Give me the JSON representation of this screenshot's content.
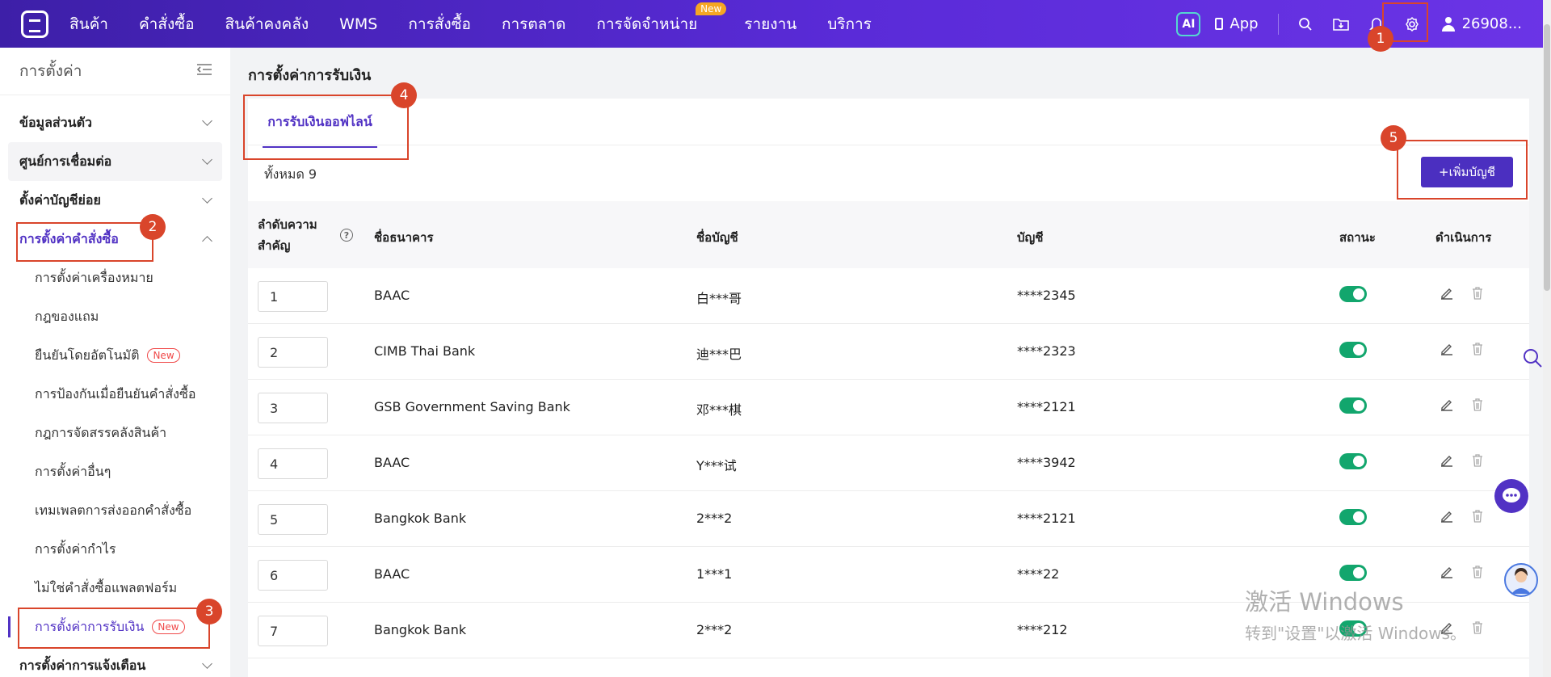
{
  "nav": {
    "items": [
      "สินค้า",
      "คำสั่งซื้อ",
      "สินค้าคงคลัง",
      "WMS",
      "การสั่งซื้อ",
      "การตลาด",
      "การจัดจำหน่าย",
      "รายงาน",
      "บริการ"
    ],
    "new_badge": "New",
    "ai_label": "AI",
    "app_label": "App",
    "user_label": "26908..."
  },
  "sidebar": {
    "title": "การตั้งค่า",
    "groups": [
      "ข้อมูลส่วนตัว",
      "ศูนย์การเชื่อมต่อ",
      "ตั้งค่าบัญชีย่อย",
      "การตั้งค่าคำสั่งซื้อ"
    ],
    "sub_items": [
      "การตั้งค่าเครื่องหมาย",
      "กฎของแถม",
      "ยืนยันโดยอัตโนมัติ",
      "การป้องกันเมื่อยืนยันคำสั่งซื้อ",
      "กฎการจัดสรรคลังสินค้า",
      "การตั้งค่าอื่นๆ",
      "เทมเพลตการส่งออกคำสั่งซื้อ",
      "การตั้งค่ากำไร",
      "ไม่ใช่คำสั่งซื้อแพลตฟอร์ม",
      "การตั้งค่าการรับเงิน"
    ],
    "new_tag": "New",
    "last_group": "การตั้งค่าการแจ้งเตือน"
  },
  "main": {
    "title": "การตั้งค่าการรับเงิน",
    "tab": "การรับเงินออฟไลน์",
    "total": "ทั้งหมด 9",
    "add_button": "+เพิ่มบัญชี",
    "headers": {
      "priority_line1": "ลำดับความ",
      "priority_line2": "สำคัญ",
      "help": "?",
      "bank": "ชื่อธนาคาร",
      "account_name": "ชื่อบัญชี",
      "account": "บัญชี",
      "status": "สถานะ",
      "actions": "ดำเนินการ"
    },
    "rows": [
      {
        "priority": "1",
        "bank": "BAAC",
        "account_name": "白***哥",
        "account": "****2345"
      },
      {
        "priority": "2",
        "bank": "CIMB Thai Bank",
        "account_name": "迪***巴",
        "account": "****2323"
      },
      {
        "priority": "3",
        "bank": "GSB Government Saving Bank",
        "account_name": "邓***棋",
        "account": "****2121"
      },
      {
        "priority": "4",
        "bank": "BAAC",
        "account_name": "Y***试",
        "account": "****3942"
      },
      {
        "priority": "5",
        "bank": "Bangkok Bank",
        "account_name": "2***2",
        "account": "****2121"
      },
      {
        "priority": "6",
        "bank": "BAAC",
        "account_name": "1***1",
        "account": "****22"
      },
      {
        "priority": "7",
        "bank": "Bangkok Bank",
        "account_name": "2***2",
        "account": "****212"
      }
    ]
  },
  "annotations": [
    "1",
    "2",
    "3",
    "4",
    "5"
  ],
  "watermark": {
    "line1": "激活 Windows",
    "line2": "转到\"设置\"以激活 Windows。"
  },
  "colors": {
    "brand": "#5132c4",
    "annotation": "#d9452b",
    "toggle_on": "#12a66d"
  }
}
